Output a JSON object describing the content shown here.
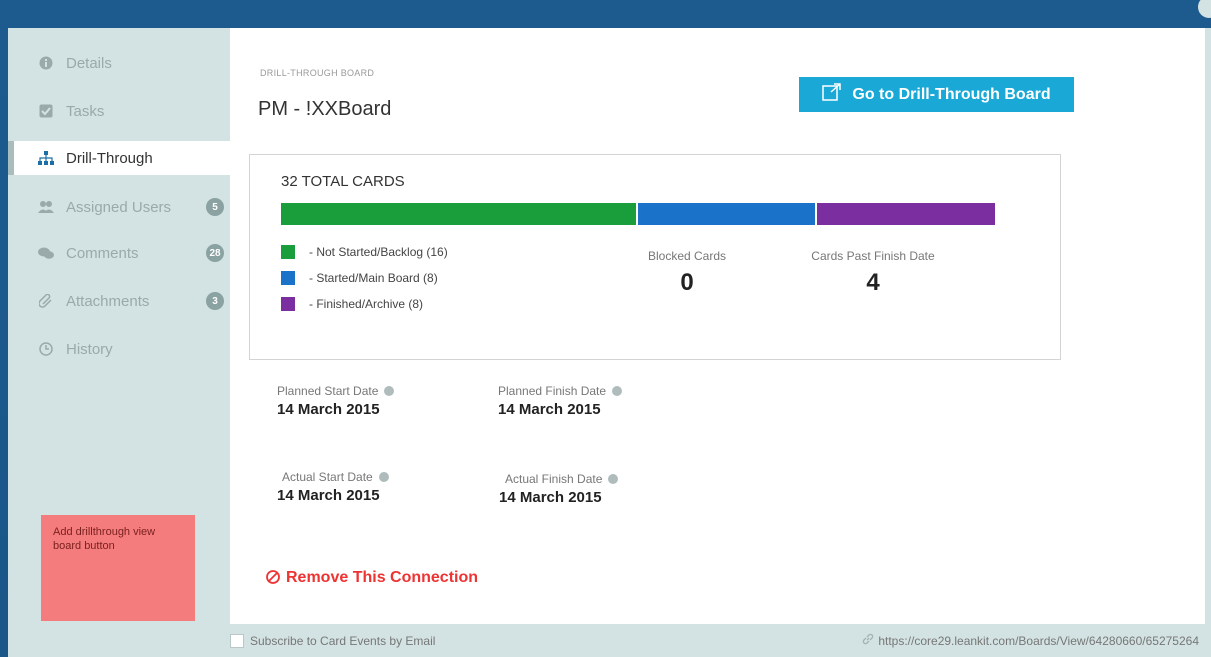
{
  "sidebar": {
    "items": [
      {
        "label": "Details",
        "icon": "info-icon"
      },
      {
        "label": "Tasks",
        "icon": "checkbox-icon"
      },
      {
        "label": "Drill-Through",
        "icon": "hierarchy-icon",
        "active": true
      },
      {
        "label": "Assigned Users",
        "icon": "users-icon",
        "badge": "5"
      },
      {
        "label": "Comments",
        "icon": "comments-icon",
        "badge": "28"
      },
      {
        "label": "Attachments",
        "icon": "paperclip-icon",
        "badge": "3"
      },
      {
        "label": "History",
        "icon": "clock-icon"
      }
    ],
    "sticky_note": "Add drillthrough view board button"
  },
  "main": {
    "eyebrow": "DRILL-THROUGH BOARD",
    "board_title": "PM - !XXBoard",
    "goto_button": "Go to Drill-Through Board",
    "total_cards": "32 TOTAL CARDS",
    "progress": [
      {
        "label": "- Not Started/Backlog (16)",
        "count": 16,
        "color": "#1a9e3c"
      },
      {
        "label": "- Started/Main Board (8)",
        "count": 8,
        "color": "#1a73c9"
      },
      {
        "label": "- Finished/Archive (8)",
        "count": 8,
        "color": "#7b2ea0"
      }
    ],
    "blocked": {
      "label": "Blocked Cards",
      "value": "0"
    },
    "past_finish": {
      "label": "Cards Past Finish Date",
      "value": "4"
    },
    "planned_start": {
      "label": "Planned Start Date",
      "value": "14 March 2015"
    },
    "planned_finish": {
      "label": "Planned Finish Date",
      "value": "14 March 2015"
    },
    "actual_start": {
      "label": "Actual Start Date",
      "value": "14 March 2015"
    },
    "actual_finish": {
      "label": "Actual Finish Date",
      "value": "14 March 2015"
    },
    "remove_link": "Remove This Connection"
  },
  "footer": {
    "subscribe_label": "Subscribe to Card Events by Email",
    "url": "https://core29.leankit.com/Boards/View/64280660/65275264"
  }
}
